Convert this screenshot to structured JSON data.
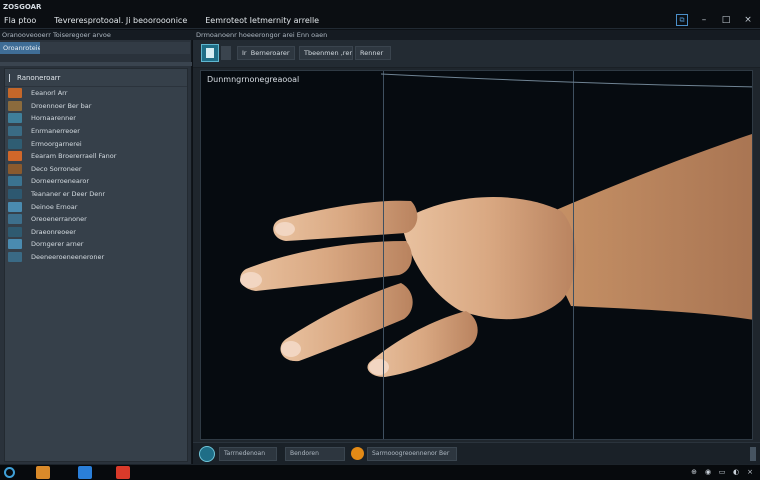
{
  "app": {
    "name": "ZOSGOAR"
  },
  "menu": [
    "Fla ptoo",
    "Tevreresprotooal. Ji beoorooonice",
    "Eemroteot Ietmernity arrelle"
  ],
  "window_controls": {
    "restore": "⧉",
    "minimize": "–",
    "maximize": "□",
    "close": "×"
  },
  "strip": {
    "left": "Oranooveooerr  Toiseregoer  arvoe",
    "right": "Drmoanoenr hoeeerongor arei  Enn oaen"
  },
  "left_panel": {
    "tab": "Oroanroteiea",
    "tree_header": "Ranoneroarr",
    "items": [
      {
        "label": "Eeanorl  Arr",
        "icon_color": "#c4672a"
      },
      {
        "label": "Droennoer  Ber  bar",
        "icon_color": "#8b6b3d"
      },
      {
        "label": "Hornaarenner",
        "icon_color": "#3f7f9a"
      },
      {
        "label": "Enrmanerreoer",
        "icon_color": "#3a6b84"
      },
      {
        "label": "Ermoorgarnerei",
        "icon_color": "#2f5d73"
      },
      {
        "label": "Eearam  Broererraell  Fanor",
        "icon_color": "#d0672a"
      },
      {
        "label": "Deco  Sorroneer",
        "icon_color": "#8a5a2e"
      },
      {
        "label": "Dorneerroenearor",
        "icon_color": "#3b7390"
      },
      {
        "label": "Teananer er Deer Denr",
        "icon_color": "#2d5870"
      },
      {
        "label": "Deinoe  Ernoar",
        "icon_color": "#4a8bb0"
      },
      {
        "label": "Oreoenerranoner",
        "icon_color": "#3d6f8c"
      },
      {
        "label": "Draeonreoeer",
        "icon_color": "#2f5a70"
      },
      {
        "label": "Dorngerer  arner",
        "icon_color": "#4a8bb0"
      },
      {
        "label": "Deeneeroeneeneroner",
        "icon_color": "#3a6a85"
      }
    ]
  },
  "main": {
    "toolbar": {
      "btn1": "Ir",
      "btn2": "Berneroarer",
      "btn3": "Tbeenmen ,rer",
      "btn4": "Renner"
    },
    "viewport_label": "Dunmngrnonegreaooal"
  },
  "status": {
    "field1": "Tarrnedenoan",
    "field2": "Bendoren",
    "field3": "Sarmooogreoennenor  Ber"
  },
  "taskbar": {
    "apps": [
      {
        "name": "folder-app",
        "color": "#d98a2a"
      },
      {
        "name": "chat-app",
        "color": "#2a7fd9"
      },
      {
        "name": "media-app",
        "color": "#d93a2a"
      }
    ],
    "tray": {
      "network": "⊕",
      "volume": "◉",
      "battery": "▭",
      "chat": "◐",
      "close": "×"
    }
  }
}
